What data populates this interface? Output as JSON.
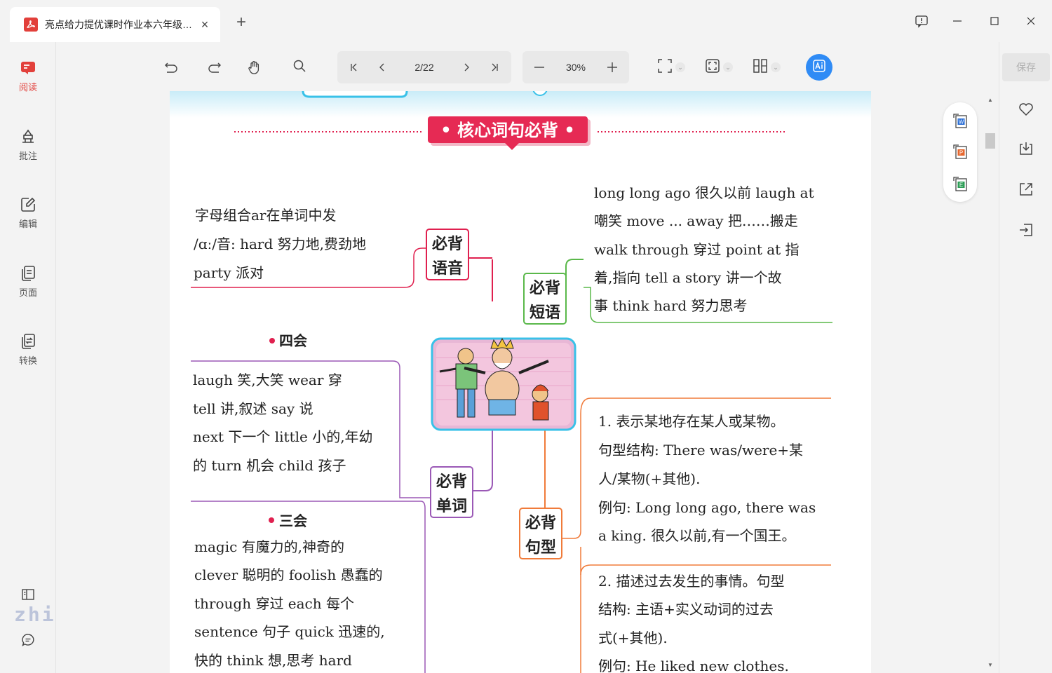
{
  "tab": {
    "title": "亮点给力提优课时作业本六年级上册...",
    "close": "×"
  },
  "new_tab": "+",
  "sidebar": {
    "items": [
      {
        "label": "阅读"
      },
      {
        "label": "批注"
      },
      {
        "label": "编辑"
      },
      {
        "label": "页面"
      },
      {
        "label": "转换"
      }
    ],
    "watermark": "zhishi.im"
  },
  "toolbar": {
    "page_indicator": "2/22",
    "zoom": "30%"
  },
  "right_panel": {
    "save_label": "保存"
  },
  "document": {
    "heading": "• 核心词句必背 •",
    "nodes": {
      "pronunciation": [
        "必背",
        "语音"
      ],
      "phrases": [
        "必背",
        "短语"
      ],
      "words": [
        "必背",
        "单词"
      ],
      "sentences": [
        "必背",
        "句型"
      ]
    },
    "pronunciation_text": [
      "字母组合ar在单词中发",
      "/ɑː/音: hard 努力地,费劲地",
      "party 派对"
    ],
    "phrases_text": [
      "long long ago 很久以前    laugh at",
      "嘲笑    move ... away 把……搬走",
      "walk through 穿过    point at 指",
      "着,指向    tell a story 讲一个故",
      "事    think hard 努力思考"
    ],
    "four_skills": {
      "title": "四会",
      "lines": [
        "laugh 笑,大笑    wear 穿",
        "tell 讲,叙述    say 说",
        "next 下一个   little 小的,年幼",
        "的    turn 机会    child 孩子"
      ]
    },
    "three_skills": {
      "title": "三会",
      "lines": [
        "magic 有魔力的,神奇的",
        "clever 聪明的    foolish 愚蠢的",
        "through 穿过    each 每个",
        "sentence 句子    quick 迅速的,",
        "快的    think 想,思考    hard"
      ]
    },
    "sentence1": [
      "1. 表示某地存在某人或某物。",
      "句型结构: There was/were+某",
      "人/某物(+其他).",
      "例句: Long long ago, there was",
      "a king. 很久以前,有一个国王。"
    ],
    "sentence2": [
      "2. 描述过去发生的事情。句型",
      "结构: 主语+实义动词的过去",
      "式(+其他).",
      "例句: He liked new clothes."
    ]
  }
}
